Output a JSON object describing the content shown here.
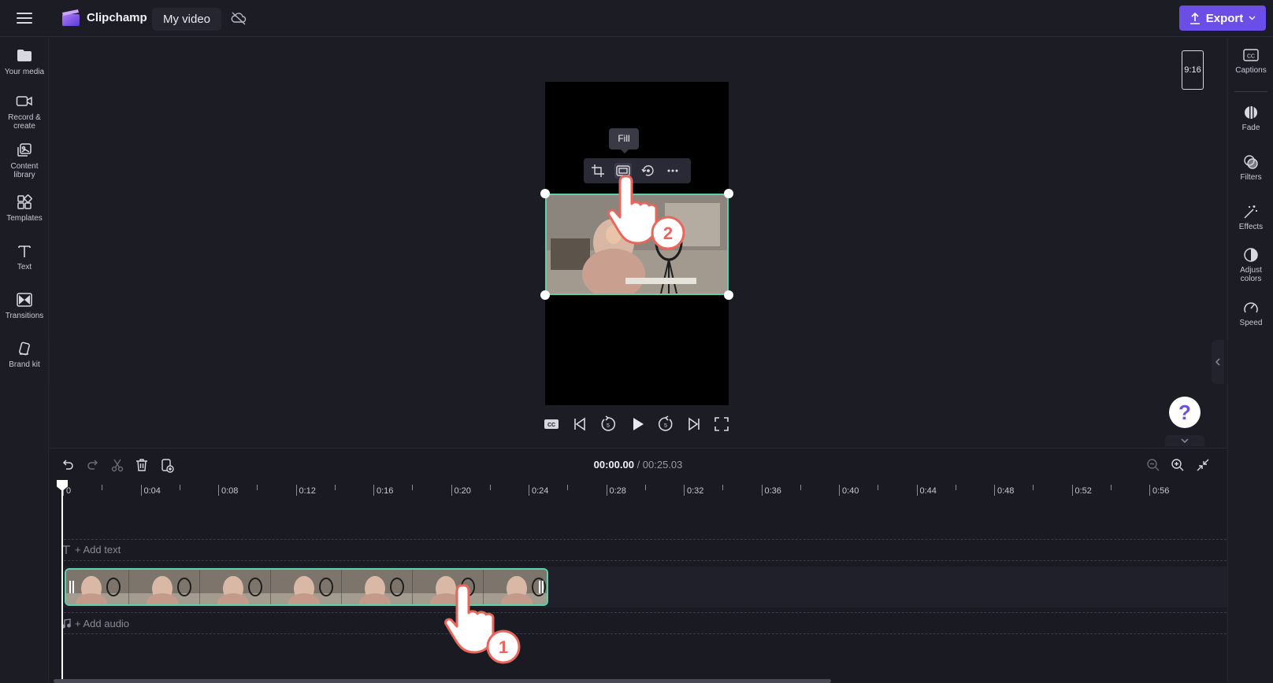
{
  "app": {
    "name": "Clipchamp",
    "video_name": "My video",
    "export_label": "Export"
  },
  "left_sidebar": [
    {
      "label": "Your media",
      "icon": "folder-icon"
    },
    {
      "label": "Record &\ncreate",
      "icon": "camera-icon"
    },
    {
      "label": "Content\nlibrary",
      "icon": "library-icon"
    },
    {
      "label": "Templates",
      "icon": "templates-icon"
    },
    {
      "label": "Text",
      "icon": "text-icon"
    },
    {
      "label": "Transitions",
      "icon": "transitions-icon"
    },
    {
      "label": "Brand kit",
      "icon": "brand-kit-icon"
    }
  ],
  "right_sidebar": [
    {
      "label": "Captions",
      "icon": "captions-icon"
    },
    {
      "label": "Fade",
      "icon": "fade-icon"
    },
    {
      "label": "Filters",
      "icon": "filters-icon"
    },
    {
      "label": "Effects",
      "icon": "effects-icon"
    },
    {
      "label": "Adjust\ncolors",
      "icon": "adjust-colors-icon"
    },
    {
      "label": "Speed",
      "icon": "speed-icon"
    }
  ],
  "preview": {
    "aspect_ratio": "9:16",
    "tooltip": "Fill",
    "help": "?"
  },
  "timeline": {
    "current_time": "00:00.00",
    "total_time": "/ 00:25.03",
    "ruler_labels": [
      "0",
      "0:04",
      "0:08",
      "0:12",
      "0:16",
      "0:20",
      "0:24",
      "0:28",
      "0:32",
      "0:36",
      "0:40",
      "0:44",
      "0:48",
      "0:52",
      "0:56"
    ],
    "add_text": "+ Add text",
    "add_audio": "+ Add audio"
  },
  "annotations": {
    "step1": "1",
    "step2": "2"
  },
  "colors": {
    "accent": "#6b4ee6",
    "selection": "#5fd1a8",
    "annotation": "#e8665c"
  }
}
